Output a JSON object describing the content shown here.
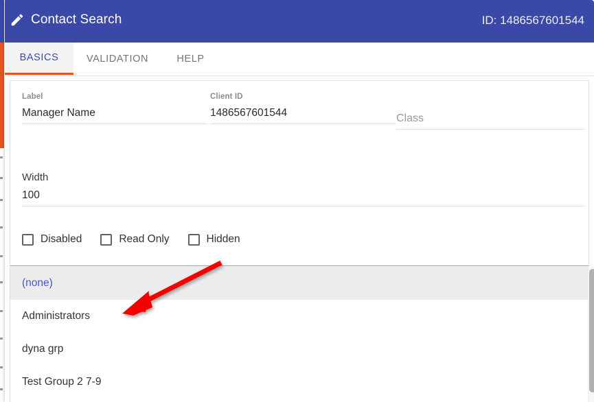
{
  "window": {
    "title": "Contact Search",
    "title_icon": "pencil-icon",
    "id_label": "ID: 1486567601544"
  },
  "tabs": [
    {
      "label": "BASICS",
      "active": true
    },
    {
      "label": "VALIDATION",
      "active": false
    },
    {
      "label": "HELP",
      "active": false
    }
  ],
  "form": {
    "label_field": {
      "label": "Label",
      "value": "Manager Name"
    },
    "client_id_field": {
      "label": "Client ID",
      "value": "1486567601544"
    },
    "class_field": {
      "label": "Class",
      "placeholder": "Class",
      "value": ""
    },
    "width_field": {
      "label": "Width",
      "value": "100"
    },
    "checkboxes": [
      {
        "label": "Disabled",
        "checked": false
      },
      {
        "label": "Read Only",
        "checked": false
      },
      {
        "label": "Hidden",
        "checked": false
      }
    ]
  },
  "list": {
    "items": [
      {
        "label": "(none)",
        "selected": true
      },
      {
        "label": "Administrators",
        "selected": false
      },
      {
        "label": "dyna grp",
        "selected": false
      },
      {
        "label": "Test Group 2 7-9",
        "selected": false
      }
    ]
  },
  "annotation": {
    "arrow_color": "#f40000",
    "arrow_from": "322,383",
    "arrow_to": "181,456"
  },
  "colors": {
    "header_blue": "#3a49a8",
    "tab_accent_orange": "#e2561d",
    "active_tab_text": "#3b4ba8",
    "selected_row_bg": "#ececec",
    "selected_row_text": "#4a57c4"
  }
}
